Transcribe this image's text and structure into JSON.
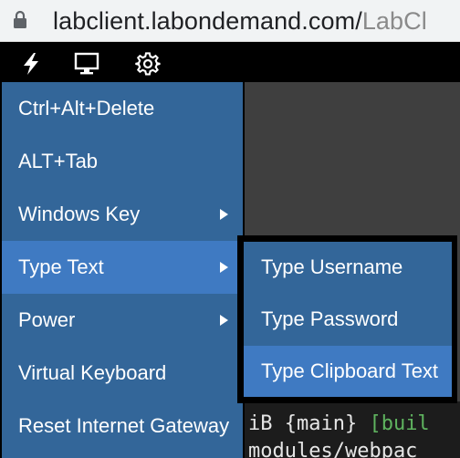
{
  "browser": {
    "url_host": "labclient.labondemand.com/",
    "url_path": "LabCl",
    "icon": "lock-icon"
  },
  "toolbar": {
    "icons": [
      "lightning-icon",
      "monitor-icon",
      "gear-icon"
    ]
  },
  "menu": {
    "items": [
      {
        "label": "Ctrl+Alt+Delete",
        "has_submenu": false
      },
      {
        "label": "ALT+Tab",
        "has_submenu": false
      },
      {
        "label": "Windows Key",
        "has_submenu": true
      },
      {
        "label": "Type Text",
        "has_submenu": true,
        "active": true
      },
      {
        "label": "Power",
        "has_submenu": true
      },
      {
        "label": "Virtual Keyboard",
        "has_submenu": false
      },
      {
        "label": "Reset Internet Gateway",
        "has_submenu": false
      }
    ]
  },
  "submenu": {
    "items": [
      {
        "label": "Type Username"
      },
      {
        "label": "Type Password"
      },
      {
        "label": "Type Clipboard Text",
        "hover": true
      }
    ]
  },
  "terminal": {
    "line1_a": "iB {main} ",
    "line1_b": "[buil",
    "line2": "modules/webpac"
  },
  "colors": {
    "menu_bg": "#336699",
    "menu_active": "#3f7ac2",
    "toolbar_bg": "#000000"
  }
}
